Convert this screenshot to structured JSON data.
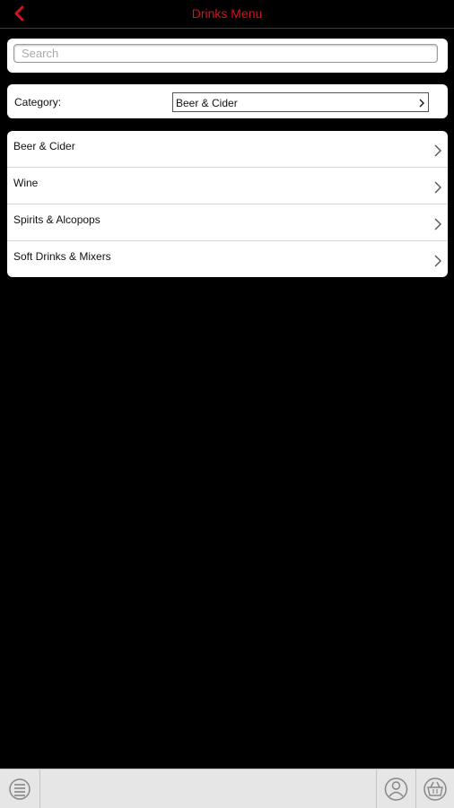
{
  "header": {
    "title": "Drinks Menu",
    "back_icon": "chevron-left-icon",
    "accent_color": "#d4141c"
  },
  "search": {
    "placeholder": "Search",
    "value": ""
  },
  "category": {
    "label": "Category:",
    "selected": "Beer & Cider"
  },
  "list": {
    "items": [
      {
        "label": "Beer & Cider"
      },
      {
        "label": "Wine"
      },
      {
        "label": "Spirits & Alcopops"
      },
      {
        "label": "Soft Drinks & Mixers"
      }
    ]
  },
  "footer": {
    "icons": [
      "menu-icon",
      "account-icon",
      "basket-icon"
    ]
  }
}
